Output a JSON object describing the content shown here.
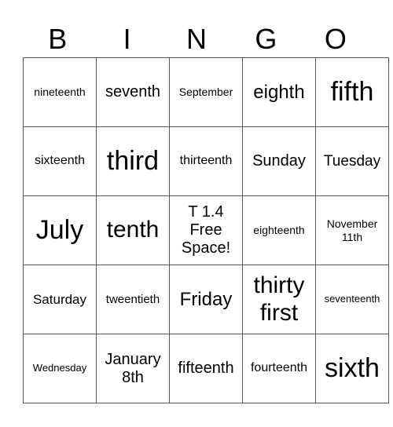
{
  "header": [
    "B",
    "I",
    "N",
    "G",
    "O"
  ],
  "rows": [
    [
      "nineteenth",
      "seventh",
      "September",
      "eighth",
      "fifth"
    ],
    [
      "sixteenth",
      "third",
      "thirteenth",
      "Sunday",
      "Tuesday"
    ],
    [
      "July",
      "tenth",
      "T 1.4 Free Space!",
      "eighteenth",
      "November 11th"
    ],
    [
      "Saturday",
      "tweentieth",
      "Friday",
      "thirty first",
      "seventeenth"
    ],
    [
      "Wednesday",
      "January 8th",
      "fifteenth",
      "fourteenth",
      "sixth"
    ]
  ]
}
